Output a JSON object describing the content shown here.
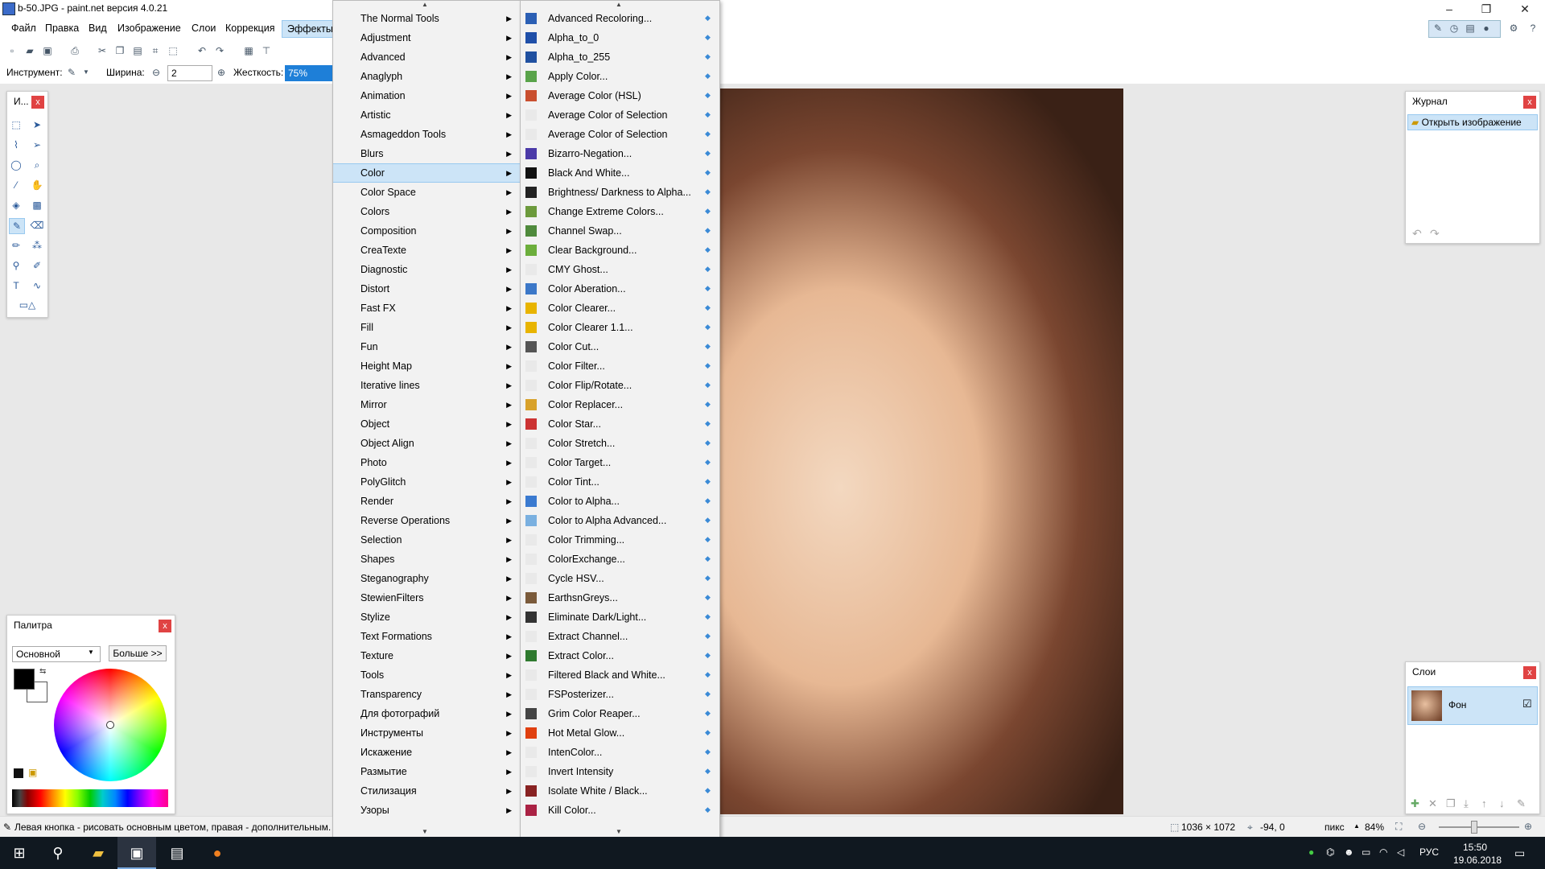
{
  "window": {
    "title": "b-50.JPG - paint.net версия 4.0.21",
    "minimize": "–",
    "restore": "❐",
    "close": "✕"
  },
  "menubar": {
    "items": [
      "Файл",
      "Правка",
      "Вид",
      "Изображение",
      "Слои",
      "Коррекция",
      "Эффекты"
    ],
    "active": "Эффекты"
  },
  "toolbar": {
    "tool_label": "Инструмент:",
    "width_label": "Ширина:",
    "width_value": "2",
    "hardness_label": "Жесткость:",
    "hardness_value": "75%"
  },
  "tools_panel": {
    "title": "И...",
    "close": "x"
  },
  "effects_menu": {
    "items": [
      "The Normal Tools",
      "Adjustment",
      "Advanced",
      "Anaglyph",
      "Animation",
      "Artistic",
      "Asmageddon Tools",
      "Blurs",
      "Color",
      "Color Space",
      "Colors",
      "Composition",
      "CreaTexte",
      "Diagnostic",
      "Distort",
      "Fast FX",
      "Fill",
      "Fun",
      "Height Map",
      "Iterative lines",
      "Mirror",
      "Object",
      "Object Align",
      "Photo",
      "PolyGlitch",
      "Render",
      "Reverse Operations",
      "Selection",
      "Shapes",
      "Steganography",
      "StewienFilters",
      "Stylize",
      "Text Formations",
      "Texture",
      "Tools",
      "Transparency",
      "Для фотографий",
      "Инструменты",
      "Искажение",
      "Размытие",
      "Стилизация",
      "Узоры"
    ],
    "highlighted": "Color"
  },
  "color_submenu": {
    "items": [
      "Advanced Recoloring...",
      "Alpha_to_0",
      "Alpha_to_255",
      "Apply Color...",
      "Average Color (HSL)",
      "Average Color of Selection",
      "Average Color of Selection",
      "Bizarro-Negation...",
      "Black And White...",
      "Brightness/ Darkness to Alpha...",
      "Change Extreme Colors...",
      "Channel Swap...",
      "Clear Background...",
      "CMY Ghost...",
      "Color Aberation...",
      "Color Clearer...",
      "Color Clearer 1.1...",
      "Color Cut...",
      "Color Filter...",
      "Color Flip/Rotate...",
      "Color Replacer...",
      "Color Star...",
      "Color Stretch...",
      "Color Target...",
      "Color Tint...",
      "Color to Alpha...",
      "Color to Alpha Advanced...",
      "Color Trimming...",
      "ColorExchange...",
      "Cycle HSV...",
      "EarthsnGreys...",
      "Eliminate Dark/Light...",
      "Extract Channel...",
      "Extract Color...",
      "Filtered Black and White...",
      "FSPosterizer...",
      "Grim Color Reaper...",
      "Hot Metal Glow...",
      "IntenColor...",
      "Invert Intensity",
      "Isolate White / Black...",
      "Kill Color..."
    ],
    "icon_colors": [
      "#2b5fb4",
      "#1f4fa8",
      "#2050a0",
      "#59a34a",
      "#c94f2f",
      "#e9e9e9",
      "#e9e9e9",
      "#4b3aa8",
      "#111111",
      "#222222",
      "#6c9a3c",
      "#4f8a3c",
      "#6cae3c",
      "#e9e9e9",
      "#3c78c8",
      "#e8b400",
      "#e8b400",
      "#555555",
      "#e9e9e9",
      "#e9e9e9",
      "#d8a12a",
      "#cc3333",
      "#e9e9e9",
      "#e9e9e9",
      "#e9e9e9",
      "#3a7ad0",
      "#7ab0e0",
      "#e9e9e9",
      "#e9e9e9",
      "#e9e9e9",
      "#7a5a3a",
      "#333333",
      "#e9e9e9",
      "#2f7a2f",
      "#e9e9e9",
      "#e9e9e9",
      "#444444",
      "#e04010",
      "#e9e9e9",
      "#e9e9e9",
      "#882222",
      "#aa2244"
    ]
  },
  "history_panel": {
    "title": "Журнал",
    "close": "x",
    "item": "Открыть изображение"
  },
  "palette_panel": {
    "title": "Палитра",
    "close": "x",
    "mode": "Основной",
    "more_button": "Больше >>"
  },
  "layers_panel": {
    "title": "Слои",
    "close": "x",
    "layer_name": "Фон"
  },
  "statusbar": {
    "hint": "Левая кнопка - рисовать основным цветом, правая - дополнительным.",
    "size": "1036 × 1072",
    "position": "-94, 0",
    "unit": "пикс",
    "zoom": "84%"
  },
  "taskbar": {
    "language": "РУС",
    "time": "15:50",
    "date": "19.06.2018"
  }
}
